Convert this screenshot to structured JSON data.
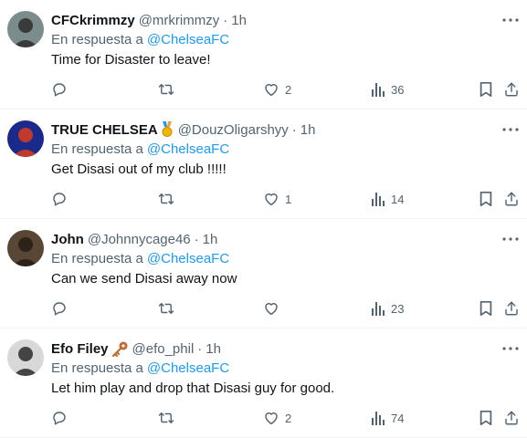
{
  "replies": [
    {
      "name": "CFCkrimmzy",
      "badge": "",
      "handle": "@mrkrimmzy",
      "time": "1h",
      "replying_label": "En respuesta a",
      "mention": "@ChelseaFC",
      "text": "Time for Disaster to leave!",
      "likes": "2",
      "views": "36",
      "avatar_colors": [
        "#7b8c8c",
        "#3a3a3a"
      ]
    },
    {
      "name": "TRUE CHELSEA",
      "badge": "medal",
      "handle": "@DouzOligarshyy",
      "time": "1h",
      "replying_label": "En respuesta a",
      "mention": "@ChelseaFC",
      "text": "Get Disasi out of my club !!!!!",
      "likes": "1",
      "views": "14",
      "avatar_colors": [
        "#1a2a8a",
        "#c0392b"
      ]
    },
    {
      "name": "John",
      "badge": "",
      "handle": "@Johnnycage46",
      "time": "1h",
      "replying_label": "En respuesta a",
      "mention": "@ChelseaFC",
      "text": "Can we send Disasi away now",
      "likes": "",
      "views": "23",
      "avatar_colors": [
        "#5a4634",
        "#2b221a"
      ]
    },
    {
      "name": "Efo Filey",
      "badge": "key",
      "handle": "@efo_phil",
      "time": "1h",
      "replying_label": "En respuesta a",
      "mention": "@ChelseaFC",
      "text": "Let him play and drop that Disasi guy for good.",
      "likes": "2",
      "views": "74",
      "avatar_colors": [
        "#d8d8d8",
        "#444444"
      ]
    }
  ],
  "separator": "·",
  "icons": [
    "more-icon",
    "reply-icon",
    "retweet-icon",
    "like-icon",
    "views-icon",
    "bookmark-icon",
    "share-icon"
  ],
  "colors": {
    "link": "#1d9bf0",
    "secondary": "#536471",
    "text": "#0f1419",
    "divider": "#eff3f4"
  }
}
